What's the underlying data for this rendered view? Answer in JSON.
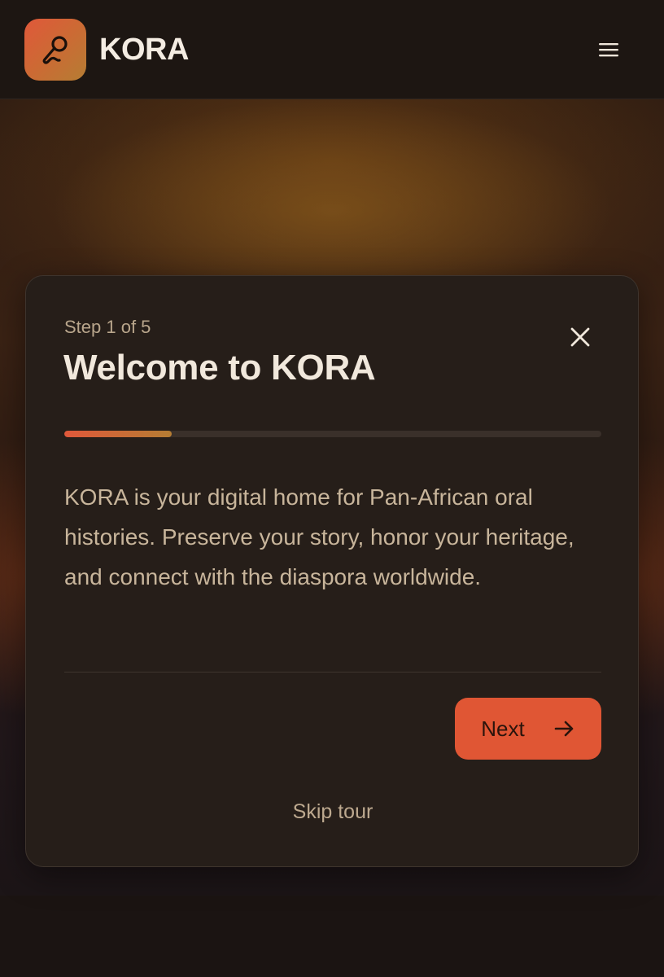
{
  "header": {
    "brand": "KORA",
    "logo_icon": "microphone-icon",
    "menu_icon": "hamburger-menu-icon"
  },
  "colors": {
    "accent": "#e05634",
    "accent_secondary": "#b57d33",
    "card_background": "#261e19",
    "page_background": "#1a1411"
  },
  "tour": {
    "step_label": "Step 1 of 5",
    "title": "Welcome to KORA",
    "progress": 0.2,
    "body": "KORA is your digital home for Pan-African oral histories. Preserve your story, honor your heritage, and connect with the diaspora worldwide.",
    "next_label": "Next",
    "next_icon": "arrow-right-icon",
    "close_icon": "close-icon",
    "skip_label": "Skip tour"
  }
}
